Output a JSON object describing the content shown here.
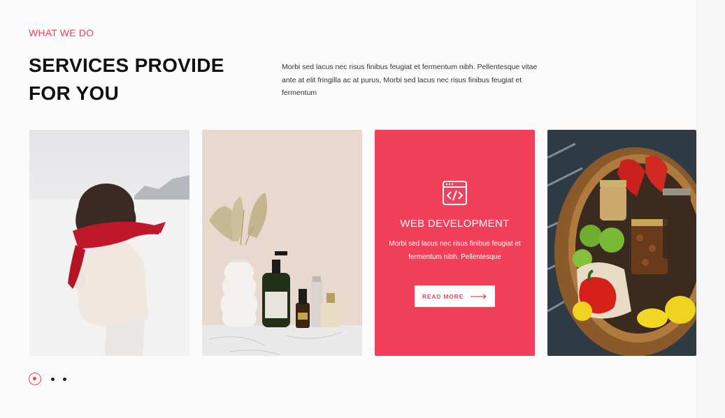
{
  "section": {
    "eyebrow": "WHAT WE DO",
    "title_line1": "SERVICES PROVIDE",
    "title_line2": "FOR YOU",
    "intro": "Morbi sed lacus nec risus finibus feugiat et fermentum nibh. Pellentesque vitae ante at elit fringilla ac at purus, Morbi sed lacus nec risus finibus feugiat et fermentum"
  },
  "cards": [
    {
      "type": "image",
      "subject": "woman with red scarf in snow"
    },
    {
      "type": "image",
      "subject": "vase with dried palm leaves and cosmetic bottles"
    },
    {
      "type": "service",
      "icon": "code-window-icon",
      "title": "WEB DEVELOPMENT",
      "description": "Morbi sed lacus nec risus finibus feugiat et fermentum nibh. Pellentesque",
      "button_label": "READ MORE"
    },
    {
      "type": "image",
      "subject": "wicker basket with vegetables and jars"
    }
  ],
  "carousel": {
    "pages": 3,
    "active": 1
  },
  "colors": {
    "accent": "#f2405a",
    "heading": "#111111",
    "background": "#fbfbfc"
  }
}
